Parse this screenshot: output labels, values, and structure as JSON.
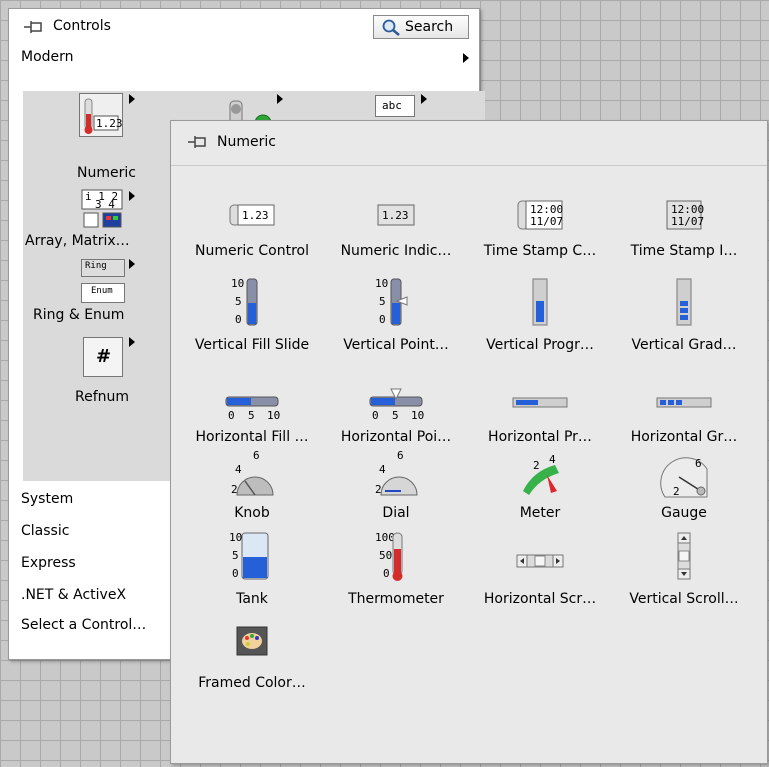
{
  "controls_palette": {
    "title": "Controls",
    "search_label": "Search",
    "modern_label": "Modern",
    "modern_items": [
      {
        "label": "Numeric"
      },
      {
        "label": "Array, Matrix…"
      },
      {
        "label": "Ring & Enum"
      },
      {
        "label": "Refnum"
      }
    ],
    "icon_text": {
      "numeric_value": "1.23",
      "string_value": "abc",
      "ring": "Ring",
      "enum": "Enum",
      "refnum": "#"
    },
    "categories": [
      {
        "label": "System"
      },
      {
        "label": "Classic"
      },
      {
        "label": "Express"
      },
      {
        "label": ".NET & ActiveX"
      },
      {
        "label": "Select a Control…"
      }
    ]
  },
  "numeric_palette": {
    "title": "Numeric",
    "items": [
      {
        "label": "Numeric Control",
        "icon": "numeric-control-icon"
      },
      {
        "label": "Numeric Indic…",
        "icon": "numeric-indicator-icon"
      },
      {
        "label": "Time Stamp C…",
        "icon": "time-stamp-control-icon"
      },
      {
        "label": "Time Stamp I…",
        "icon": "time-stamp-indicator-icon"
      },
      {
        "label": "Vertical Fill Slide",
        "icon": "vertical-fill-slide-icon"
      },
      {
        "label": "Vertical Point…",
        "icon": "vertical-pointer-slide-icon"
      },
      {
        "label": "Vertical Progr…",
        "icon": "vertical-progress-bar-icon"
      },
      {
        "label": "Vertical Grad…",
        "icon": "vertical-graduated-bar-icon"
      },
      {
        "label": "Horizontal Fill …",
        "icon": "horizontal-fill-slide-icon"
      },
      {
        "label": "Horizontal Poi…",
        "icon": "horizontal-pointer-slide-icon"
      },
      {
        "label": "Horizontal Pr…",
        "icon": "horizontal-progress-bar-icon"
      },
      {
        "label": "Horizontal Gr…",
        "icon": "horizontal-graduated-bar-icon"
      },
      {
        "label": "Knob",
        "icon": "knob-icon"
      },
      {
        "label": "Dial",
        "icon": "dial-icon"
      },
      {
        "label": "Meter",
        "icon": "meter-icon"
      },
      {
        "label": "Gauge",
        "icon": "gauge-icon"
      },
      {
        "label": "Tank",
        "icon": "tank-icon"
      },
      {
        "label": "Thermometer",
        "icon": "thermometer-icon"
      },
      {
        "label": "Horizontal Scr…",
        "icon": "horizontal-scrollbar-icon"
      },
      {
        "label": "Vertical Scroll…",
        "icon": "vertical-scrollbar-icon"
      },
      {
        "label": "Framed Color…",
        "icon": "framed-color-box-icon"
      }
    ],
    "icon_text": {
      "value": "1.23",
      "time": "12:00",
      "date": "11/07",
      "scale_10": "10",
      "scale_5": "5",
      "scale_0": "0",
      "scale_100": "100",
      "scale_50": "50",
      "scale_2": "2",
      "scale_4": "4",
      "scale_6": "6"
    }
  }
}
